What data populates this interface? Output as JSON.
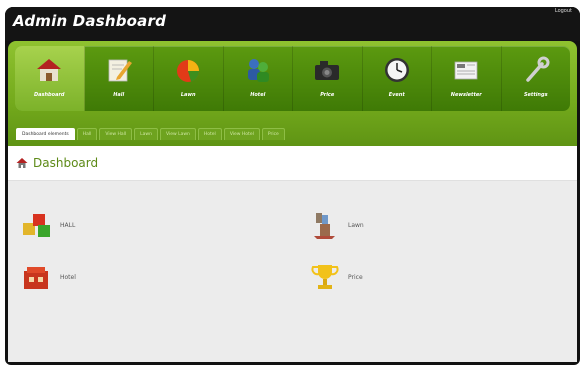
{
  "header": {
    "title": "Admin Dashboard",
    "logout_label": "Logout"
  },
  "nav": {
    "items": [
      {
        "label": "Dashboard",
        "icon": "home-icon",
        "active": true
      },
      {
        "label": "Hall",
        "icon": "edit-icon"
      },
      {
        "label": "Lawn",
        "icon": "pie-chart-icon"
      },
      {
        "label": "Hotel",
        "icon": "users-icon"
      },
      {
        "label": "Price",
        "icon": "camera-icon"
      },
      {
        "label": "Event",
        "icon": "clock-icon"
      },
      {
        "label": "Newsletter",
        "icon": "newspaper-icon"
      },
      {
        "label": "Settings",
        "icon": "wrench-icon"
      }
    ]
  },
  "tabs": [
    "Dashboard elements",
    "Hall",
    "View Hall",
    "Lawn",
    "View Lawn",
    "Hotel",
    "View Hotel",
    "Price"
  ],
  "page": {
    "title": "Dashboard"
  },
  "items": [
    {
      "label": "HALL",
      "icon": "cubes-icon"
    },
    {
      "label": "Lawn",
      "icon": "lawn-icon"
    },
    {
      "label": "Hotel",
      "icon": "hotel-icon"
    },
    {
      "label": "Price",
      "icon": "trophy-icon"
    }
  ],
  "colors": {
    "accent": "#73a91c",
    "nav_dark": "#3f7a06",
    "title_green": "#5d8a17",
    "header_black": "#141414"
  }
}
